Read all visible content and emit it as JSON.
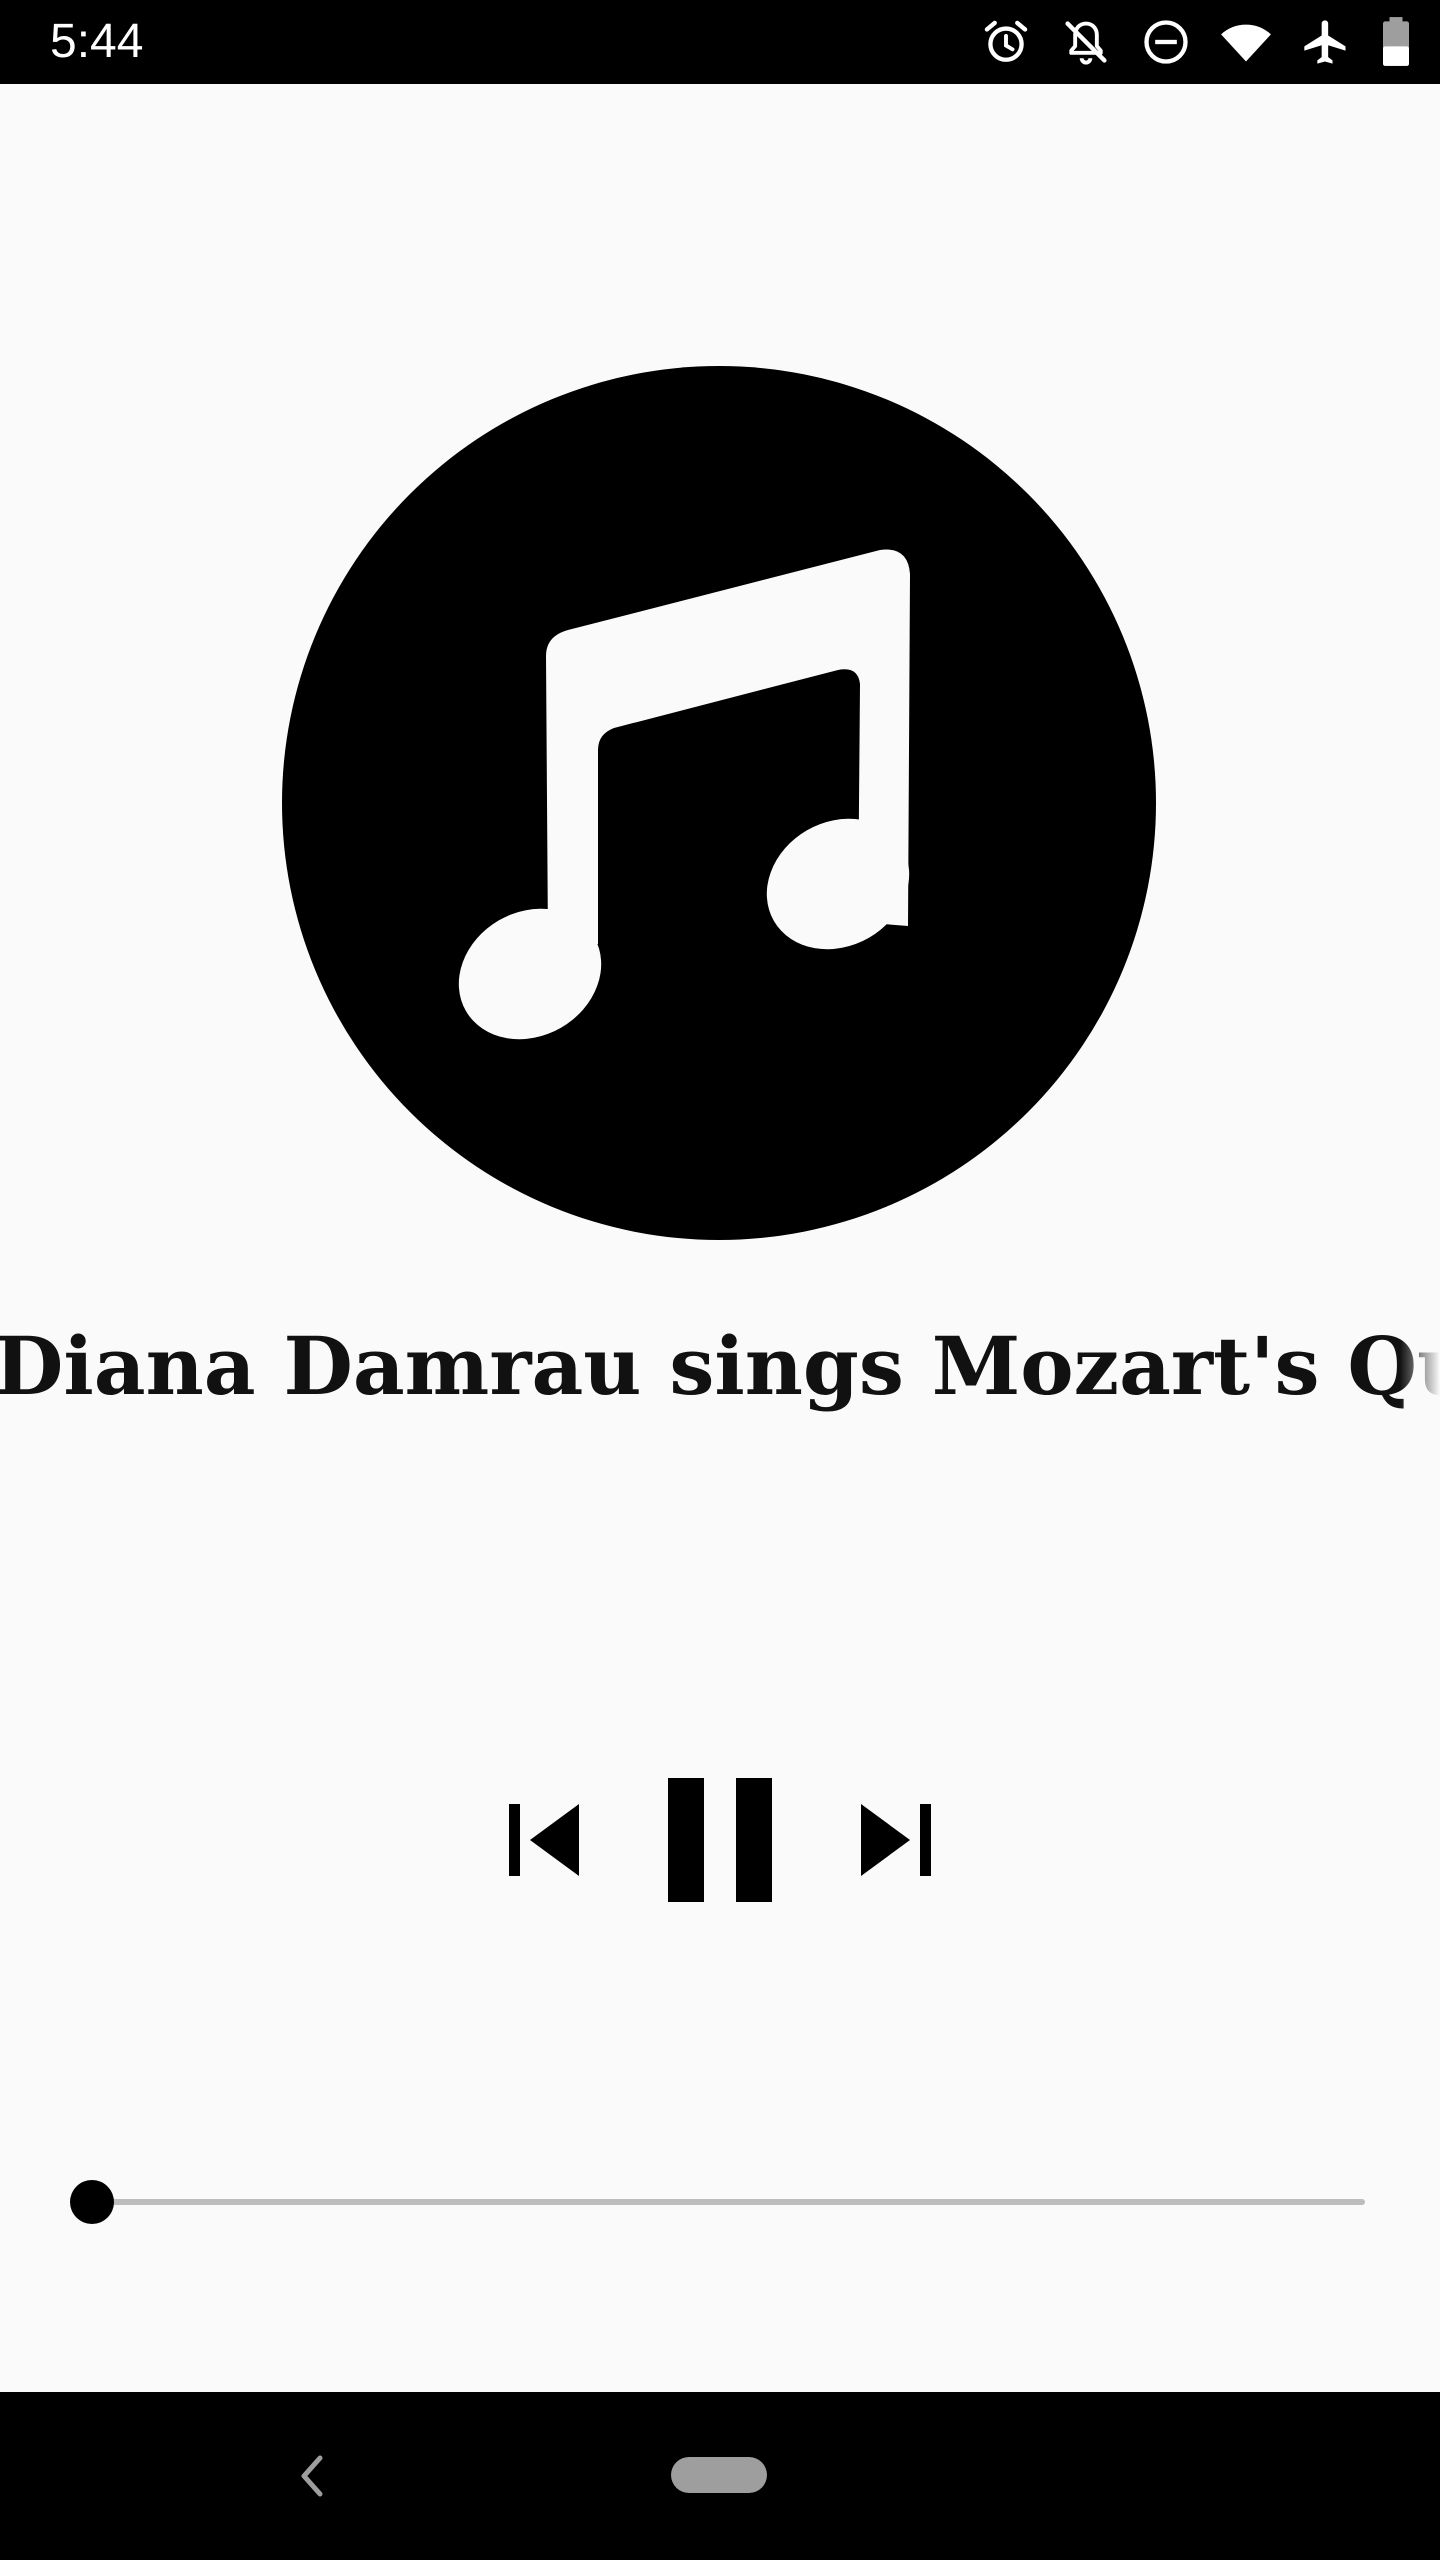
{
  "status_bar": {
    "time": "5:44",
    "icons": [
      "alarm-icon",
      "notifications-off-icon",
      "do-not-disturb-icon",
      "wifi-icon",
      "airplane-mode-icon",
      "battery-icon"
    ]
  },
  "player": {
    "album_art_icon": "music-note-icon",
    "track_title": "Diana Damrau sings Mozart's Queen of the Night",
    "controls": {
      "previous_icon": "skip-previous-icon",
      "play_pause_icon": "pause-icon",
      "next_icon": "skip-next-icon"
    },
    "progress": 0.0
  },
  "nav_bar": {
    "back_icon": "back-chevron-icon",
    "home_icon": "home-pill-icon"
  },
  "colors": {
    "background": "#fafafa",
    "foreground": "#000000",
    "seek_track": "#bdbdbd",
    "nav_home": "#9e9e9e"
  }
}
